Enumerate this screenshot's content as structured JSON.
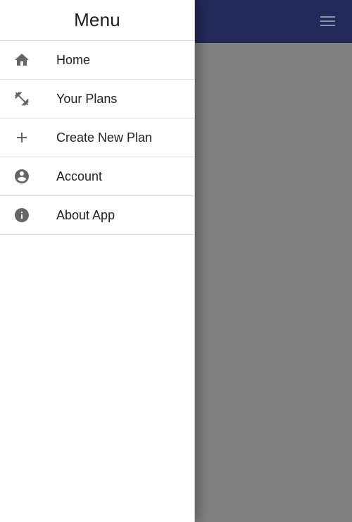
{
  "drawer": {
    "title": "Menu",
    "items": [
      {
        "label": "Home",
        "icon": "home-icon"
      },
      {
        "label": "Your Plans",
        "icon": "dumbbell-icon"
      },
      {
        "label": "Create New Plan",
        "icon": "plus-icon"
      },
      {
        "label": "Account",
        "icon": "account-circle-icon"
      },
      {
        "label": "About App",
        "icon": "info-icon"
      }
    ]
  },
  "app_bar": {
    "menu_icon": "hamburger-menu-icon",
    "color": "#232a5a"
  },
  "colors": {
    "icon": "#666666",
    "text": "#212121",
    "overlay": "#808080"
  }
}
